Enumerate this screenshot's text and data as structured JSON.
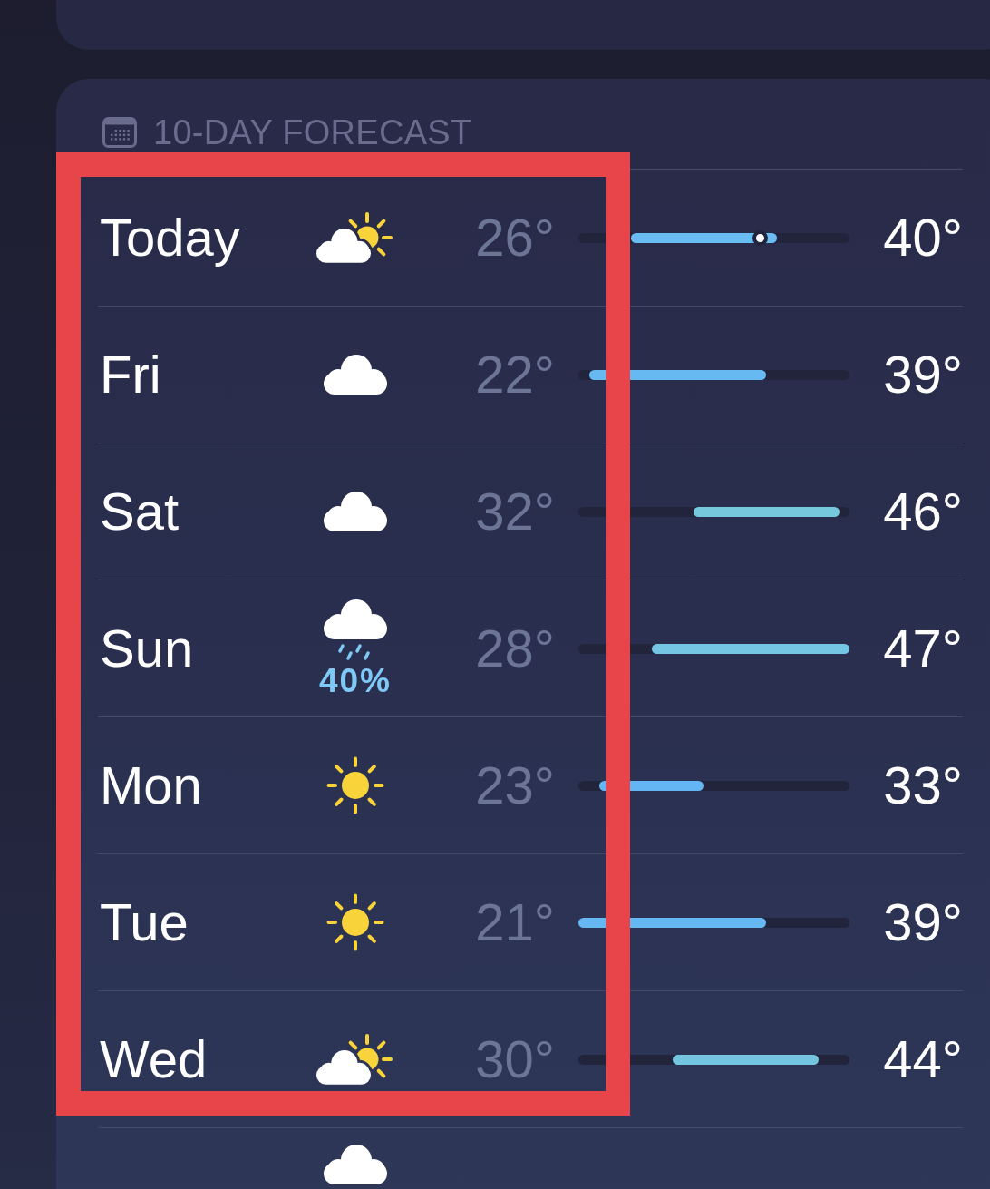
{
  "header": {
    "title": "10-DAY FORECAST"
  },
  "rows": [
    {
      "kind": "full",
      "day": "Today",
      "icon": {
        "kind": "partly_sunny"
      },
      "low": "26°",
      "high": "40°",
      "bar": {
        "color": "#6abdf3"
      },
      "now": {
        "level": 0.67
      }
    },
    {
      "kind": "full",
      "day": "Fri",
      "icon": {
        "kind": "cloud"
      },
      "low": "22°",
      "high": "39°",
      "bar": {
        "color": "#67b9f2"
      }
    },
    {
      "kind": "full",
      "day": "Sat",
      "icon": {
        "kind": "cloud"
      },
      "low": "32°",
      "high": "46°",
      "bar": {
        "color": "#76c8dc"
      }
    },
    {
      "kind": "full",
      "day": "Sun",
      "icon": {
        "kind": "rain"
      },
      "precip": "40%",
      "low": "28°",
      "high": "47°",
      "bar": {
        "color": "#74c6e4"
      }
    },
    {
      "kind": "full",
      "day": "Mon",
      "icon": {
        "kind": "sun"
      },
      "low": "23°",
      "high": "33°",
      "bar": {
        "color": "#64b5f4"
      }
    },
    {
      "kind": "full",
      "day": "Tue",
      "icon": {
        "kind": "sun"
      },
      "low": "21°",
      "high": "39°",
      "bar": {
        "color": "#66b8f2"
      }
    },
    {
      "kind": "full",
      "day": "Wed",
      "icon": {
        "kind": "partly_sunny"
      },
      "low": "30°",
      "high": "44°",
      "bar": {
        "color": "#74c6e0"
      }
    },
    {
      "kind": "cut",
      "icon": {
        "kind": "cloud"
      }
    }
  ],
  "annotation": {
    "kind": "frame"
  }
}
